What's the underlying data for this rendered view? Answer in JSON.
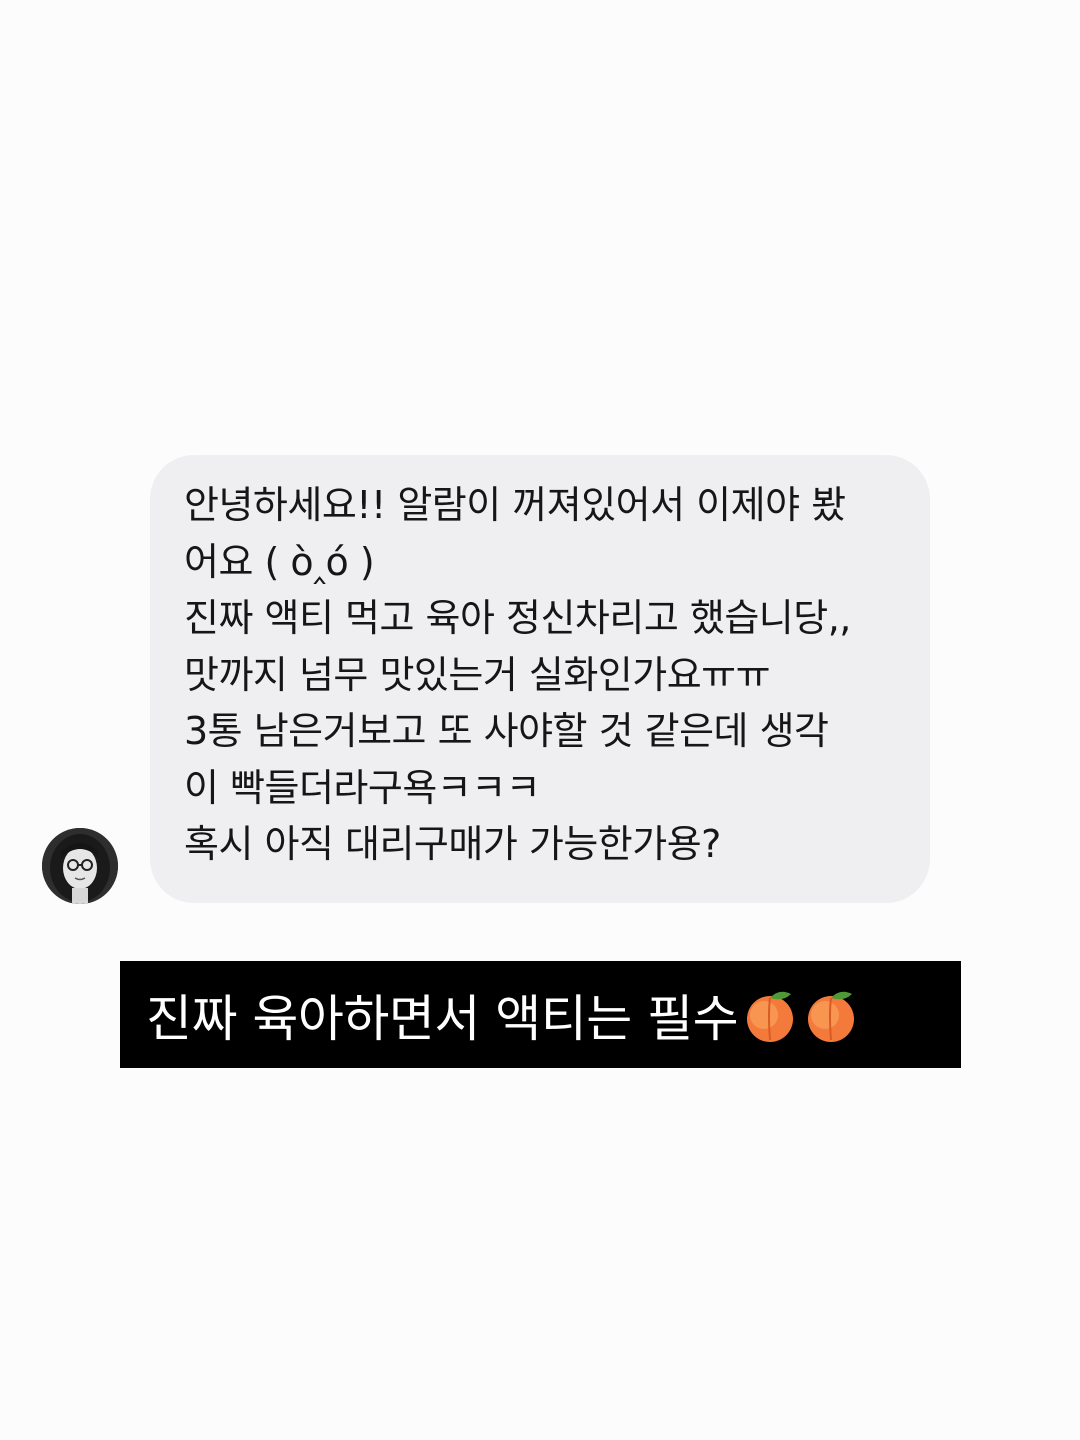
{
  "message": {
    "lines": [
      "안녕하세요!! 알람이 꺼져있어서 이제야 봤",
      "어요 ( ὸ‸ό )",
      "진짜 액티 먹고 육아 정신차리고 했습니당,,",
      "맛까지 넘무 맛있는거 실화인가요ㅠㅠ",
      "3통 남은거보고 또 사야할 것 같은데 생각",
      "이 빡들더라구욕ㅋㅋㅋ",
      "혹시 아직 대리구매가 가능한가용?"
    ],
    "bubble_color": "#efeff2"
  },
  "caption": {
    "text": "진짜 육아하면서 액티는 필수",
    "emoji": [
      "peach-icon",
      "peach-icon"
    ],
    "background": "#000000",
    "text_color": "#ffffff"
  },
  "avatar": {
    "icon": "avatar-photo"
  }
}
